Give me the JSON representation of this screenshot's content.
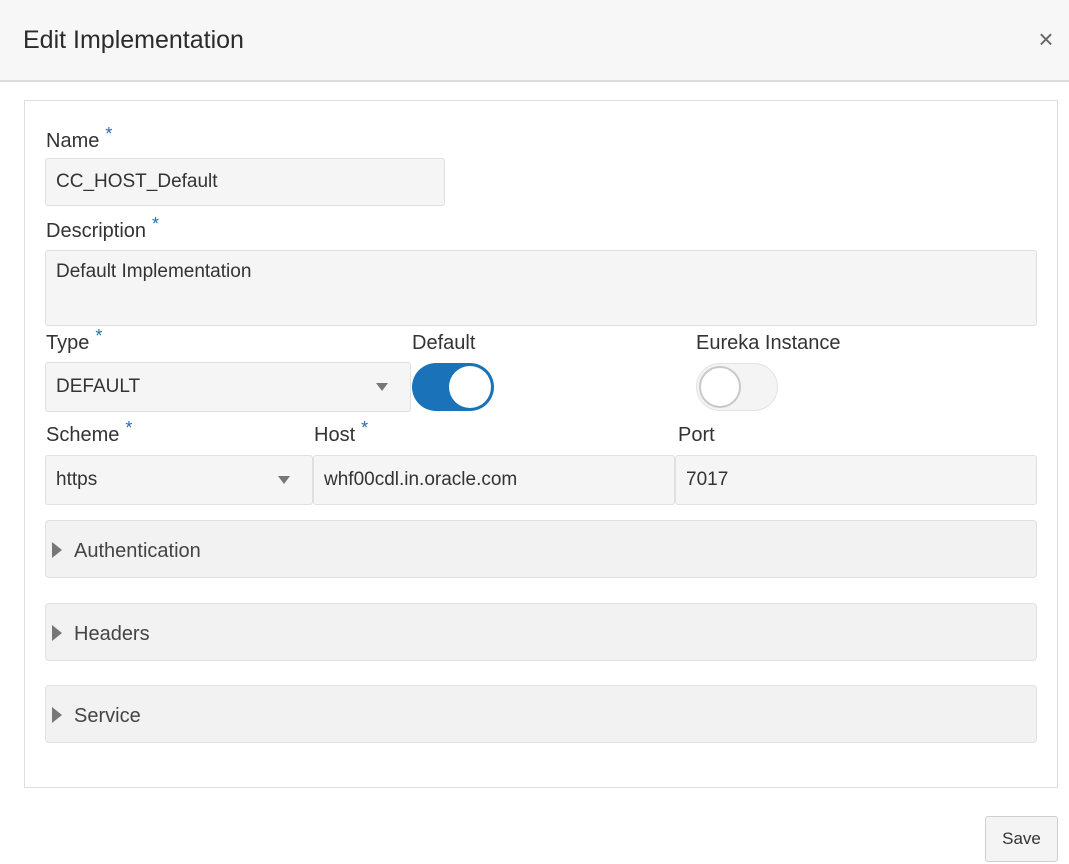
{
  "dialog": {
    "title": "Edit Implementation",
    "close_glyph": "×",
    "close_icon": "close-icon"
  },
  "form": {
    "name": {
      "label": "Name",
      "required_mark": "*",
      "value": "CC_HOST_Default"
    },
    "description": {
      "label": "Description",
      "required_mark": "*",
      "value": "Default Implementation"
    },
    "type": {
      "label": "Type",
      "required_mark": "*",
      "selected": "DEFAULT"
    },
    "default": {
      "label": "Default",
      "on": true
    },
    "eureka": {
      "label": "Eureka Instance",
      "on": false
    },
    "scheme": {
      "label": "Scheme",
      "required_mark": "*",
      "selected": "https"
    },
    "host": {
      "label": "Host",
      "required_mark": "*",
      "value": "whf00cdl.in.oracle.com"
    },
    "port": {
      "label": "Port",
      "value": "7017"
    }
  },
  "sections": [
    {
      "label": "Authentication",
      "expanded": false
    },
    {
      "label": "Headers",
      "expanded": false
    },
    {
      "label": "Service",
      "expanded": false
    }
  ],
  "footer": {
    "save_label": "Save"
  },
  "colors": {
    "accent": "#1a73b8",
    "required": "#2a6bb5",
    "field_bg": "#f5f5f5",
    "header_bg": "#f7f7f7"
  }
}
